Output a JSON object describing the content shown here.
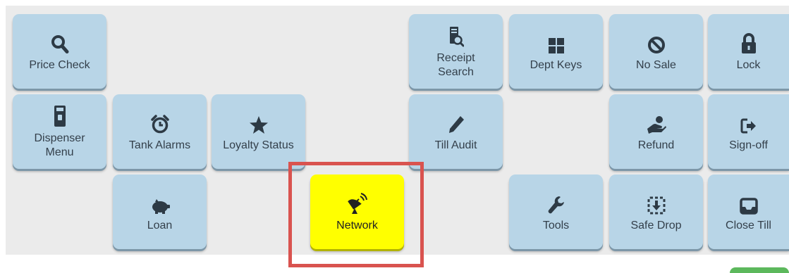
{
  "buttons": {
    "price_check": {
      "label": "Price Check",
      "icon": "search-icon"
    },
    "receipt_search": {
      "label_line1": "Receipt",
      "label_line2": "Search",
      "icon": "receipt-search-icon"
    },
    "dept_keys": {
      "label": "Dept Keys",
      "icon": "grid-icon"
    },
    "no_sale": {
      "label": "No Sale",
      "icon": "ban-icon"
    },
    "lock": {
      "label": "Lock",
      "icon": "lock-icon"
    },
    "dispenser_menu": {
      "label_line1": "Dispenser",
      "label_line2": "Menu",
      "icon": "dispenser-icon"
    },
    "tank_alarms": {
      "label": "Tank Alarms",
      "icon": "alarm-clock-icon"
    },
    "loyalty_status": {
      "label": "Loyalty Status",
      "icon": "star-icon"
    },
    "till_audit": {
      "label": "Till Audit",
      "icon": "pencil-icon"
    },
    "refund": {
      "label": "Refund",
      "icon": "refund-hand-icon"
    },
    "sign_off": {
      "label": "Sign-off",
      "icon": "sign-out-icon"
    },
    "loan": {
      "label": "Loan",
      "icon": "piggy-bank-icon"
    },
    "network": {
      "label": "Network",
      "icon": "satellite-dish-icon"
    },
    "tools": {
      "label": "Tools",
      "icon": "wrench-icon"
    },
    "safe_drop": {
      "label": "Safe Drop",
      "icon": "safe-drop-icon"
    },
    "close_till": {
      "label": "Close Till",
      "icon": "inbox-icon"
    }
  },
  "colors": {
    "button_bg": "#b8d5e7",
    "highlight_button_bg": "#ffff00",
    "highlight_border": "#d9534f",
    "panel_bg": "#ebebeb"
  }
}
